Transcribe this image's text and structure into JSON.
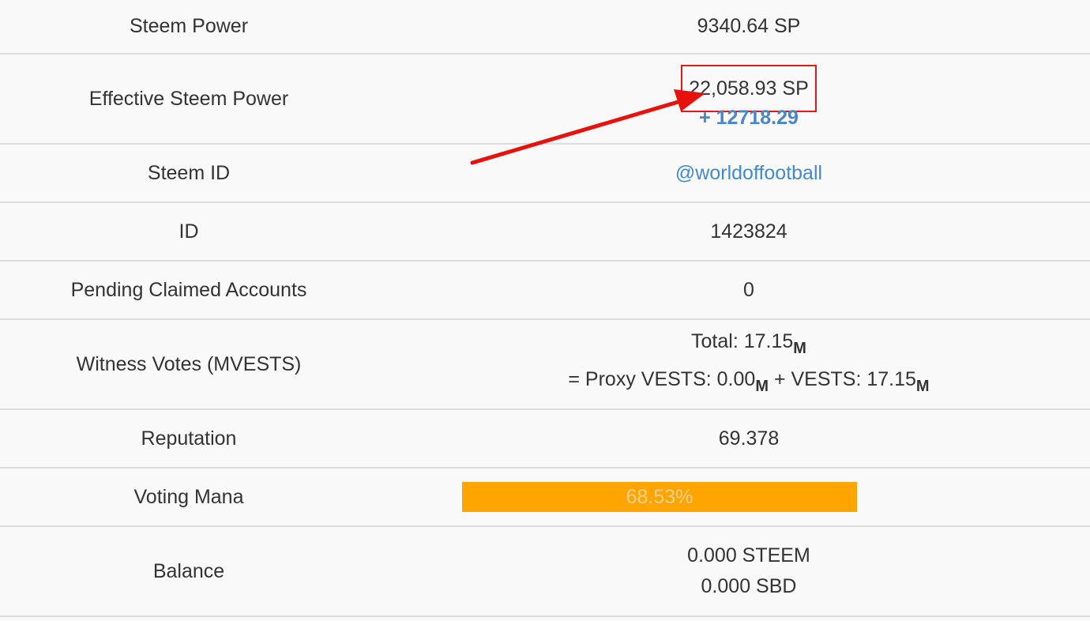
{
  "accent_link_color": "#428bca",
  "highlight_color": "#e01919",
  "mana_color": "#ffa500",
  "rows": {
    "steem_power": {
      "label": "Steem Power",
      "value": "9340.64 SP"
    },
    "effective_sp": {
      "label": "Effective Steem Power",
      "value": "22,058.93 SP",
      "bonus": "+ 12718.29"
    },
    "steem_id": {
      "label": "Steem ID",
      "value": "@worldoffootball"
    },
    "id": {
      "label": "ID",
      "value": "1423824"
    },
    "pending_claimed": {
      "label": "Pending Claimed Accounts",
      "value": "0"
    },
    "witness_votes": {
      "label": "Witness Votes (MVESTS)",
      "total_prefix": "Total: ",
      "total": "17.15",
      "proxy_prefix": "= Proxy VESTS: ",
      "proxy": "0.00",
      "vests_prefix": " + VESTS: ",
      "vests": "17.15",
      "unit": "M"
    },
    "reputation": {
      "label": "Reputation",
      "value": "69.378"
    },
    "voting_mana": {
      "label": "Voting Mana",
      "text": "68.53%",
      "fraction": 0.6853
    },
    "balance": {
      "label": "Balance",
      "steem": "0.000 STEEM",
      "sbd": "0.000 SBD"
    }
  }
}
